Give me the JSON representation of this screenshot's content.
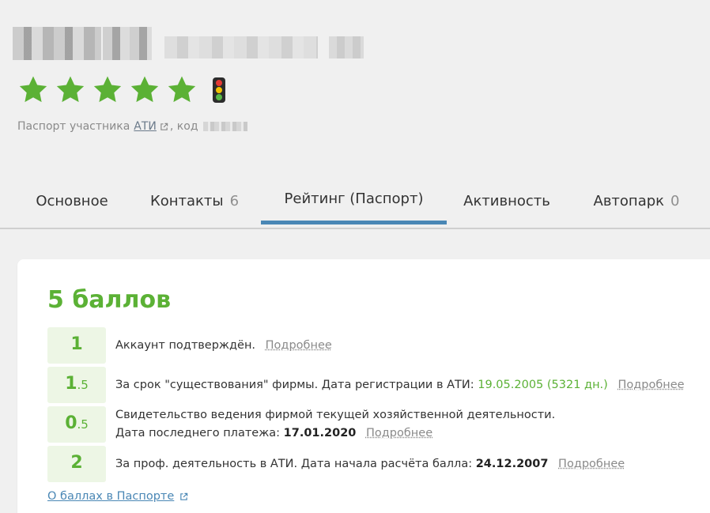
{
  "company": {
    "name_redacted_label": "",
    "rating_stars": 5,
    "star_color": "#5bb135",
    "traffic_light_colors": [
      "#e53935",
      "#f2c200",
      "#58b947"
    ]
  },
  "passport": {
    "prefix": "Паспорт участника",
    "ati_link": "АТИ",
    "code_label": ", код",
    "link_icon": "external-link-icon"
  },
  "tabs": [
    {
      "label": "Основное",
      "count": ""
    },
    {
      "label": "Контакты",
      "count": "6"
    },
    {
      "label": "Рейтинг (Паспорт)",
      "count": ""
    },
    {
      "label": "Активность",
      "count": ""
    },
    {
      "label": "Автопарк",
      "count": "0"
    }
  ],
  "active_tab_index": 2,
  "rating": {
    "title": "5 баллов",
    "rows": [
      {
        "score_int": "1",
        "score_frac": "",
        "text": "Аккаунт подтверждён.",
        "more": "Подробнее"
      },
      {
        "score_int": "1",
        "score_frac": ".5",
        "text": "За срок \"существования\" фирмы. Дата регистрации в АТИ:",
        "date": "19.05.2005 (5321 дн.)",
        "more": "Подробнее"
      },
      {
        "score_int": "0",
        "score_frac": ".5",
        "line1": "Свидетельство ведения фирмой текущей хозяйственной деятельности.",
        "line2": "Дата последнего платежа:",
        "date": "17.01.2020",
        "more": "Подробнее"
      },
      {
        "score_int": "2",
        "score_frac": "",
        "text": "За проф. деятельность в АТИ. Дата начала расчёта балла:",
        "date": "24.12.2007",
        "more": "Подробнее"
      }
    ],
    "about_link": "О баллах в Паспорте"
  },
  "colors": {
    "accent_green": "#5bb135",
    "tab_underline": "#4a87b5",
    "link_blue": "#4a87b5"
  }
}
